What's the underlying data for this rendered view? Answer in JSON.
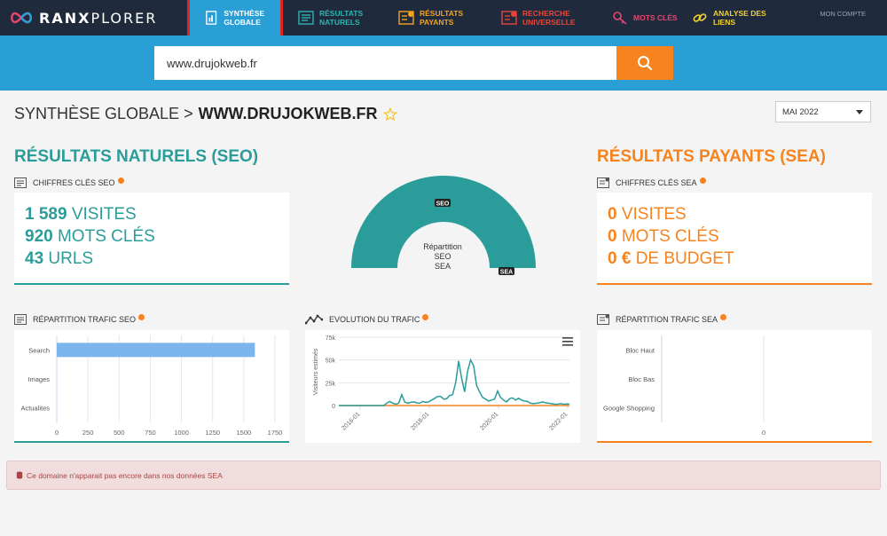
{
  "colors": {
    "teal": "#2a9d9a",
    "orange": "#f7831f",
    "navbar": "#1f2a3c",
    "brand_blue": "#2a9fd6",
    "bar_blue": "#7cb5ec"
  },
  "logo": {
    "text_bold": "RANX",
    "text_light": "PLORER"
  },
  "nav": {
    "items": [
      {
        "label": "SYNTHÈSE GLOBALE",
        "color": "#ffffff",
        "icon": "document-chart-icon"
      },
      {
        "label": "RÉSULTATS NATURELS",
        "color": "#2fb5b1",
        "icon": "list-icon"
      },
      {
        "label": "RÉSULTATS PAYANTS",
        "color": "#f7a21f",
        "icon": "euro-list-icon"
      },
      {
        "label": "RECHERCHE UNIVERSELLE",
        "color": "#e8453c",
        "icon": "universal-list-icon"
      },
      {
        "label": "MOTS CLÉS",
        "color": "#e8456e",
        "icon": "key-icon"
      },
      {
        "label": "ANALYSE DES LIENS",
        "color": "#f2d22e",
        "icon": "link-icon"
      }
    ],
    "account": "MON COMPTE"
  },
  "search": {
    "value": "www.drujokweb.fr"
  },
  "page": {
    "title_prefix": "SYNTHÈSE GLOBALE >",
    "domain": "WWW.DRUJOKWEB.FR",
    "month": "MAI 2022"
  },
  "seo": {
    "title": "RÉSULTATS NATURELS (SEO)",
    "kpi_title": "CHIFFRES CLÉS SEO",
    "kpis": [
      {
        "value": "1 589",
        "label": "VISITES"
      },
      {
        "value": "920",
        "label": "MOTS CLÉS"
      },
      {
        "value": "43",
        "label": "URLS"
      }
    ],
    "traffic_title": "RÉPARTITION TRAFIC SEO"
  },
  "sea": {
    "title": "RÉSULTATS PAYANTS (SEA)",
    "kpi_title": "CHIFFRES CLÉS SEA",
    "kpis": [
      {
        "value": "0",
        "label": "VISITES"
      },
      {
        "value": "0",
        "label": "MOTS CLÉS"
      },
      {
        "value": "0 €",
        "label": "DE BUDGET"
      }
    ],
    "traffic_title": "RÉPARTITION TRAFIC SEA"
  },
  "evolution": {
    "title": "EVOLUTION DU TRAFIC"
  },
  "alert": {
    "text": "Ce domaine n'apparait pas encore dans nos données SEA"
  },
  "chart_data": [
    {
      "type": "pie",
      "variant": "semi-donut",
      "center_label": [
        "Répartition",
        "SEO",
        "SEA"
      ],
      "labels": [
        "SEO",
        "SEA"
      ],
      "values": [
        100,
        0
      ],
      "colors": [
        "#2a9d9a",
        "#f7831f"
      ]
    },
    {
      "type": "bar",
      "orientation": "horizontal",
      "categories": [
        "Search",
        "Images",
        "Actualites"
      ],
      "values": [
        1589,
        0,
        0
      ],
      "xlim": [
        0,
        1750
      ],
      "xticks": [
        "0",
        "250",
        "500",
        "750",
        "1000",
        "1250",
        "1500",
        "1750"
      ],
      "grid": true
    },
    {
      "type": "line",
      "ylabel": "Visiteurs estimés",
      "ylim": [
        0,
        75000
      ],
      "yticks": [
        "0",
        "25k",
        "50k",
        "75k"
      ],
      "xticks": [
        "2016-01",
        "2018-01",
        "2020-01",
        "2022-01"
      ],
      "series": [
        {
          "color": "#2a9d9a",
          "values": [
            0,
            0,
            0,
            0,
            0,
            0,
            0,
            0,
            0,
            0,
            0,
            0,
            0,
            0,
            0,
            0,
            2500,
            4500,
            2500,
            1500,
            2500,
            12000,
            4000,
            2500,
            3500,
            4000,
            3000,
            2500,
            4500,
            3500,
            4000,
            6000,
            8000,
            10000,
            10000,
            7000,
            7500,
            11000,
            12000,
            25000,
            49000,
            30000,
            15000,
            38000,
            50000,
            44000,
            22000,
            15000,
            9000,
            7000,
            5000,
            6000,
            7000,
            16000,
            9000,
            6000,
            4000,
            7500,
            8500,
            6000,
            8000,
            6000,
            5000,
            4500,
            2500,
            2000,
            2500,
            3000,
            4000,
            3000,
            2500,
            2000,
            1500,
            1500,
            2000,
            1500,
            1800,
            1500
          ]
        },
        {
          "color": "#f7831f",
          "values": [
            0,
            0,
            0,
            0,
            0,
            0,
            0,
            0,
            0,
            0,
            0,
            0,
            0,
            0,
            0,
            0,
            0,
            0,
            0,
            0,
            0,
            0,
            0,
            0,
            0,
            0,
            0,
            0,
            0,
            0,
            0,
            0,
            0,
            0,
            0,
            0,
            0,
            0,
            0,
            0,
            0,
            0,
            0,
            0,
            0,
            0,
            0,
            0,
            0,
            0,
            0,
            0,
            0,
            0,
            0,
            0,
            0,
            0,
            0,
            0,
            0,
            0,
            0,
            0,
            0,
            0,
            0,
            0,
            0,
            0,
            0,
            0,
            0,
            0,
            0,
            0,
            0,
            0
          ]
        }
      ],
      "grid": true
    },
    {
      "type": "bar",
      "orientation": "horizontal",
      "categories": [
        "Bloc Haut",
        "Bloc Bas",
        "Google Shopping"
      ],
      "values": [
        0,
        0,
        0
      ],
      "xticks": [
        "0"
      ],
      "grid": true
    }
  ]
}
